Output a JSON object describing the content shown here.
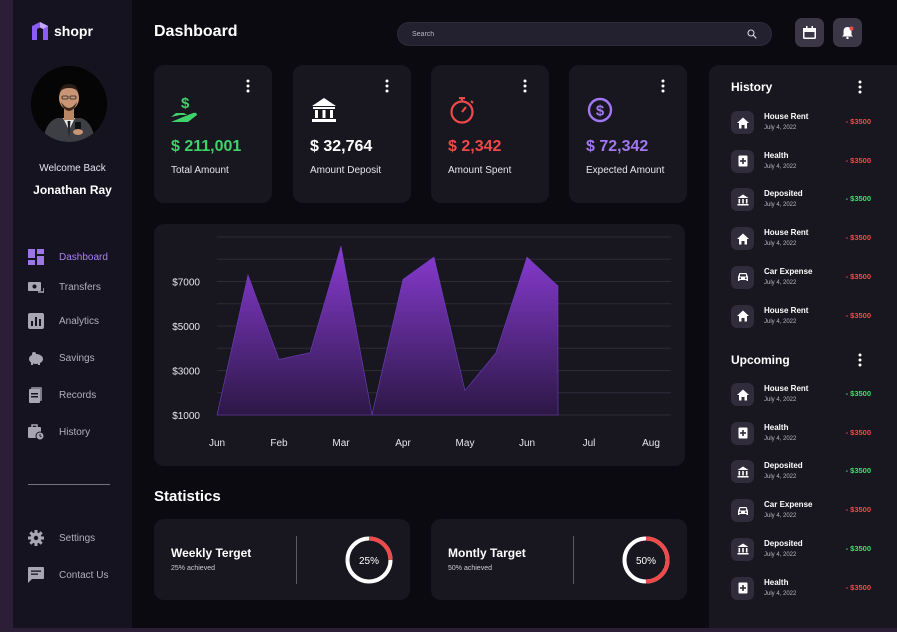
{
  "app": {
    "name": "shopr"
  },
  "user": {
    "welcome": "Welcome Back",
    "name": "Jonathan Ray"
  },
  "nav": [
    {
      "label": "Dashboard",
      "icon": "dashboard-icon",
      "active": true
    },
    {
      "label": "Transfers",
      "icon": "transfers-icon"
    },
    {
      "label": "Analytics",
      "icon": "analytics-icon"
    },
    {
      "label": "Savings",
      "icon": "piggy-bank-icon"
    },
    {
      "label": "Records",
      "icon": "records-icon"
    },
    {
      "label": "History",
      "icon": "history-icon"
    }
  ],
  "nav_bottom": [
    {
      "label": "Settings",
      "icon": "gear-icon"
    },
    {
      "label": "Contact Us",
      "icon": "chat-icon"
    }
  ],
  "header": {
    "title": "Dashboard",
    "search_placeholder": "Search"
  },
  "cards": [
    {
      "amount": "$ 211,001",
      "label": "Total Amount",
      "icon": "money-hand-icon",
      "color": "#3fd26a"
    },
    {
      "amount": "$ 32,764",
      "label": "Amount Deposit",
      "icon": "bank-icon",
      "color": "#ffffff"
    },
    {
      "amount": "$ 2,342",
      "label": "Amount Spent",
      "icon": "stopwatch-icon",
      "color": "#ef4a4a"
    },
    {
      "amount": "$ 72,342",
      "label": "Expected Amount",
      "icon": "dollar-coin-icon",
      "color": "#a177f2"
    }
  ],
  "chart_data": {
    "type": "area",
    "categories": [
      "Jun",
      "Feb",
      "Mar",
      "Apr",
      "May",
      "Jun",
      "Jul",
      "Aug"
    ],
    "x": [
      0,
      0.5,
      1,
      1.5,
      2,
      2.5,
      3,
      3.5,
      4,
      4.5,
      5,
      5.5,
      6,
      6.5,
      7
    ],
    "values": [
      1000,
      7300,
      3500,
      3800,
      8600,
      1000,
      7100,
      8100,
      2100,
      3800,
      8100,
      6800
    ],
    "ytick_labels": [
      "$1000",
      "$3000",
      "$5000",
      "$7000"
    ],
    "ylim": [
      1000,
      9000
    ],
    "grid": true,
    "color": "#8a3bd4"
  },
  "statistics": {
    "title": "Statistics",
    "items": [
      {
        "title": "Weekly Terget",
        "sub": "25% achieved",
        "percent": 25,
        "label": "25%"
      },
      {
        "title": "Montly Target",
        "sub": "50% achieved",
        "percent": 50,
        "label": "50%"
      }
    ]
  },
  "history": {
    "title": "History",
    "items": [
      {
        "name": "House Rent",
        "date": "July 4, 2022",
        "amount": "- $3500",
        "type": "neg",
        "icon": "home-icon"
      },
      {
        "name": "Health",
        "date": "July 4, 2022",
        "amount": "- $3500",
        "type": "neg",
        "icon": "medical-icon"
      },
      {
        "name": "Deposited",
        "date": "July 4, 2022",
        "amount": "- $3500",
        "type": "pos",
        "icon": "bank-icon"
      },
      {
        "name": "House Rent",
        "date": "July 4, 2022",
        "amount": "- $3500",
        "type": "neg",
        "icon": "home-icon"
      },
      {
        "name": "Car Expense",
        "date": "July 4, 2022",
        "amount": "- $3500",
        "type": "neg",
        "icon": "car-icon"
      },
      {
        "name": "House Rent",
        "date": "July 4, 2022",
        "amount": "- $3500",
        "type": "neg",
        "icon": "home-icon"
      }
    ]
  },
  "upcoming": {
    "title": "Upcoming",
    "items": [
      {
        "name": "House Rent",
        "date": "July 4, 2022",
        "amount": "- $3500",
        "type": "pos",
        "icon": "home-icon"
      },
      {
        "name": "Health",
        "date": "July 4, 2022",
        "amount": "- $3500",
        "type": "neg",
        "icon": "medical-icon"
      },
      {
        "name": "Deposited",
        "date": "July 4, 2022",
        "amount": "- $3500",
        "type": "pos",
        "icon": "bank-icon"
      },
      {
        "name": "Car Expense",
        "date": "July 4, 2022",
        "amount": "- $3500",
        "type": "neg",
        "icon": "car-icon"
      },
      {
        "name": "Deposited",
        "date": "July 4, 2022",
        "amount": "- $3500",
        "type": "pos",
        "icon": "bank-icon"
      },
      {
        "name": "Health",
        "date": "July 4, 2022",
        "amount": "- $3500",
        "type": "neg",
        "icon": "medical-icon"
      }
    ]
  }
}
